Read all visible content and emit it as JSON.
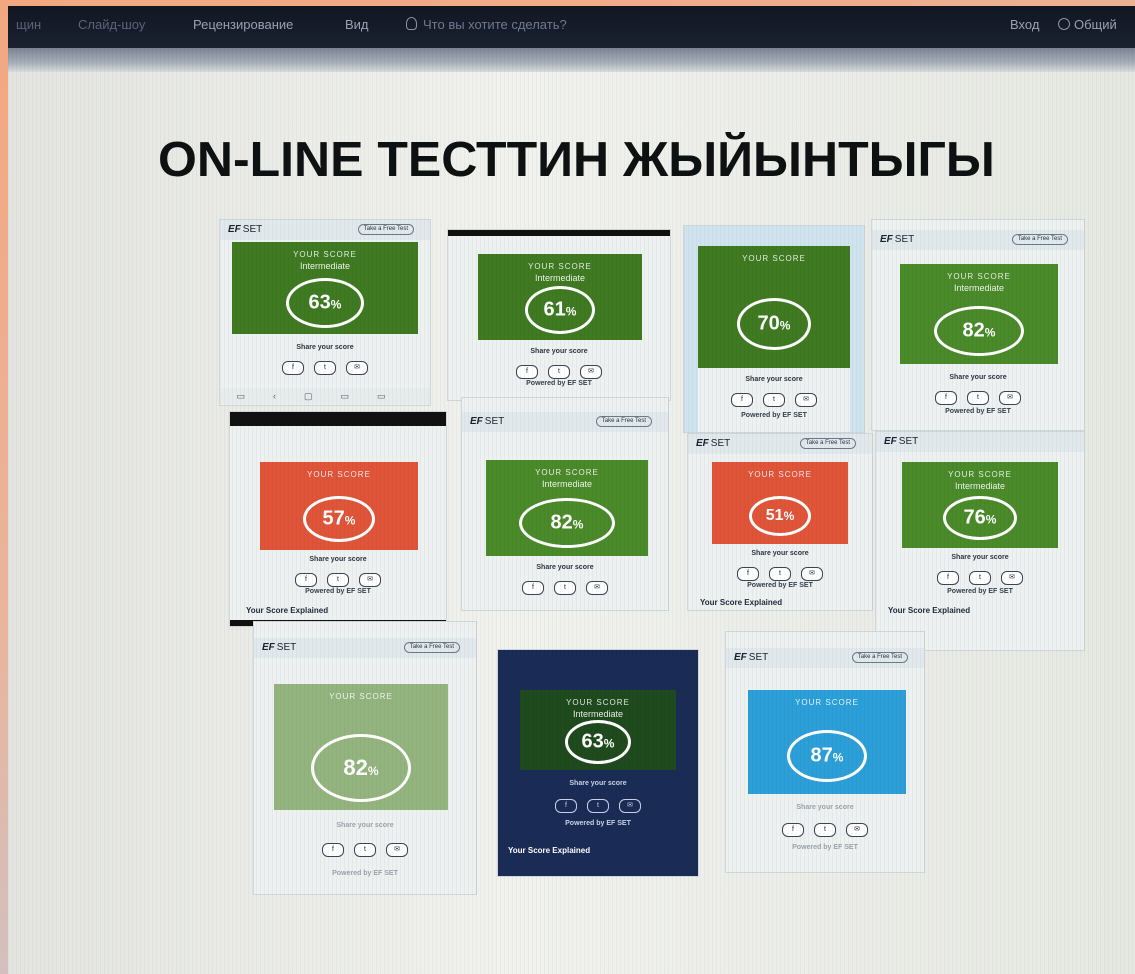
{
  "ribbon": {
    "menu_partial_1": "щин",
    "menu_slideshow": "Слайд-шоу",
    "menu_review": "Рецензирование",
    "menu_view": "Вид",
    "tell_me": "Что вы хотите сделать?",
    "sign_in": "Вход",
    "share": "Общий"
  },
  "slide": {
    "title": "ON-LINE ТЕСТТИН ЖЫЙЫНТЫГЫ"
  },
  "card_common": {
    "brand": "EF",
    "brand_suffix": "SET",
    "take_test": "Take a Free Test",
    "your_score": "YOUR SCORE",
    "share_your_score": "Share your score",
    "powered": "Powered by EF SET",
    "score_explained": "Your Score Explained",
    "pct_sign": "%",
    "icon_facebook": "f",
    "icon_twitter": "t",
    "icon_email": "✉"
  },
  "results": [
    {
      "score": "63",
      "level": "Intermediate",
      "color": "#3f7a22"
    },
    {
      "score": "61",
      "level": "Intermediate",
      "color": "#3f7a22"
    },
    {
      "score": "70",
      "level": "",
      "color": "#3f7a22"
    },
    {
      "score": "82",
      "level": "Intermediate",
      "color": "#4a8a2a"
    },
    {
      "score": "57",
      "level": "",
      "color": "#e0553a"
    },
    {
      "score": "82",
      "level": "Intermediate",
      "color": "#4a8a2a"
    },
    {
      "score": "51",
      "level": "",
      "color": "#e0553a"
    },
    {
      "score": "76",
      "level": "Intermediate",
      "color": "#4a8a2a"
    },
    {
      "score": "82",
      "level": "",
      "color": "#93b47e"
    },
    {
      "score": "63",
      "level": "Intermediate",
      "color": "#1f4a1d"
    },
    {
      "score": "87",
      "level": "",
      "color": "#2d9fd8"
    }
  ]
}
